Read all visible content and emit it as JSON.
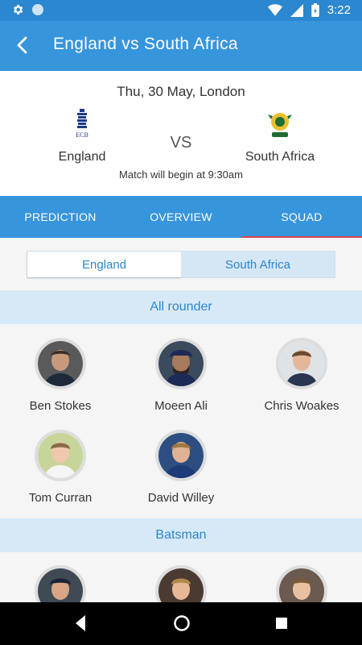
{
  "status": {
    "time": "3:22"
  },
  "header": {
    "title": "England vs South Africa"
  },
  "match": {
    "date": "Thu, 30 May, London",
    "team1": "England",
    "team2": "South Africa",
    "vs": "VS",
    "begin_text": "Match will begin at 9:30am",
    "team1_logo_text": "ECB"
  },
  "tabs": [
    "PREDICTION",
    "OVERVIEW",
    "SQUAD"
  ],
  "active_tab": "SQUAD",
  "team_toggle": {
    "selected": "England",
    "other": "South Africa"
  },
  "sections": [
    {
      "title": "All rounder",
      "players": [
        "Ben Stokes",
        "Moeen Ali",
        "Chris Woakes",
        "Tom Curran",
        "David Willey"
      ]
    },
    {
      "title": "Batsman",
      "players": []
    }
  ],
  "colors": {
    "primary": "#3795dc",
    "accent": "#e0434d",
    "section_bg": "#d7e9f7"
  }
}
